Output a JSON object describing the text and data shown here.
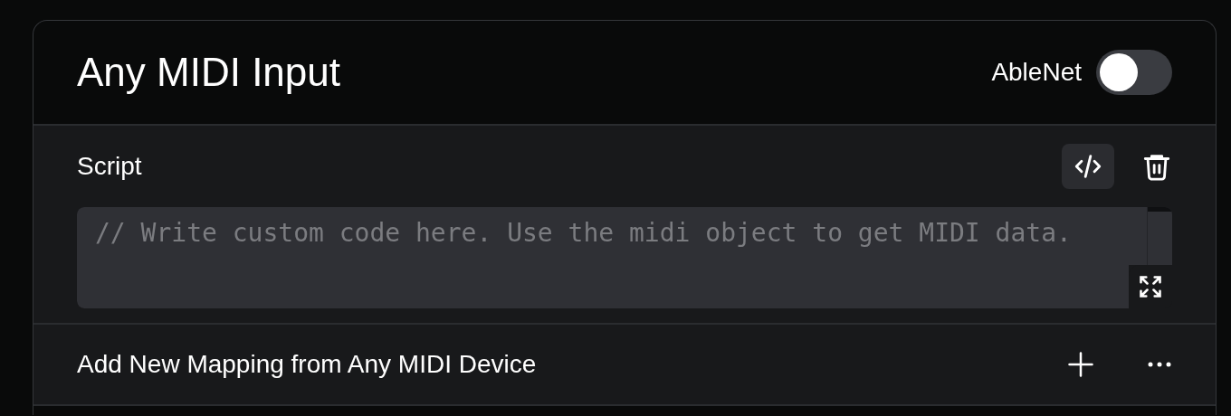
{
  "header": {
    "title": "Any MIDI Input",
    "toggle_label": "AbleNet",
    "toggle_on": false
  },
  "script": {
    "label": "Script",
    "placeholder": "// Write custom code here. Use the midi object to get MIDI data."
  },
  "mapping": {
    "label": "Add New Mapping from Any MIDI Device"
  }
}
